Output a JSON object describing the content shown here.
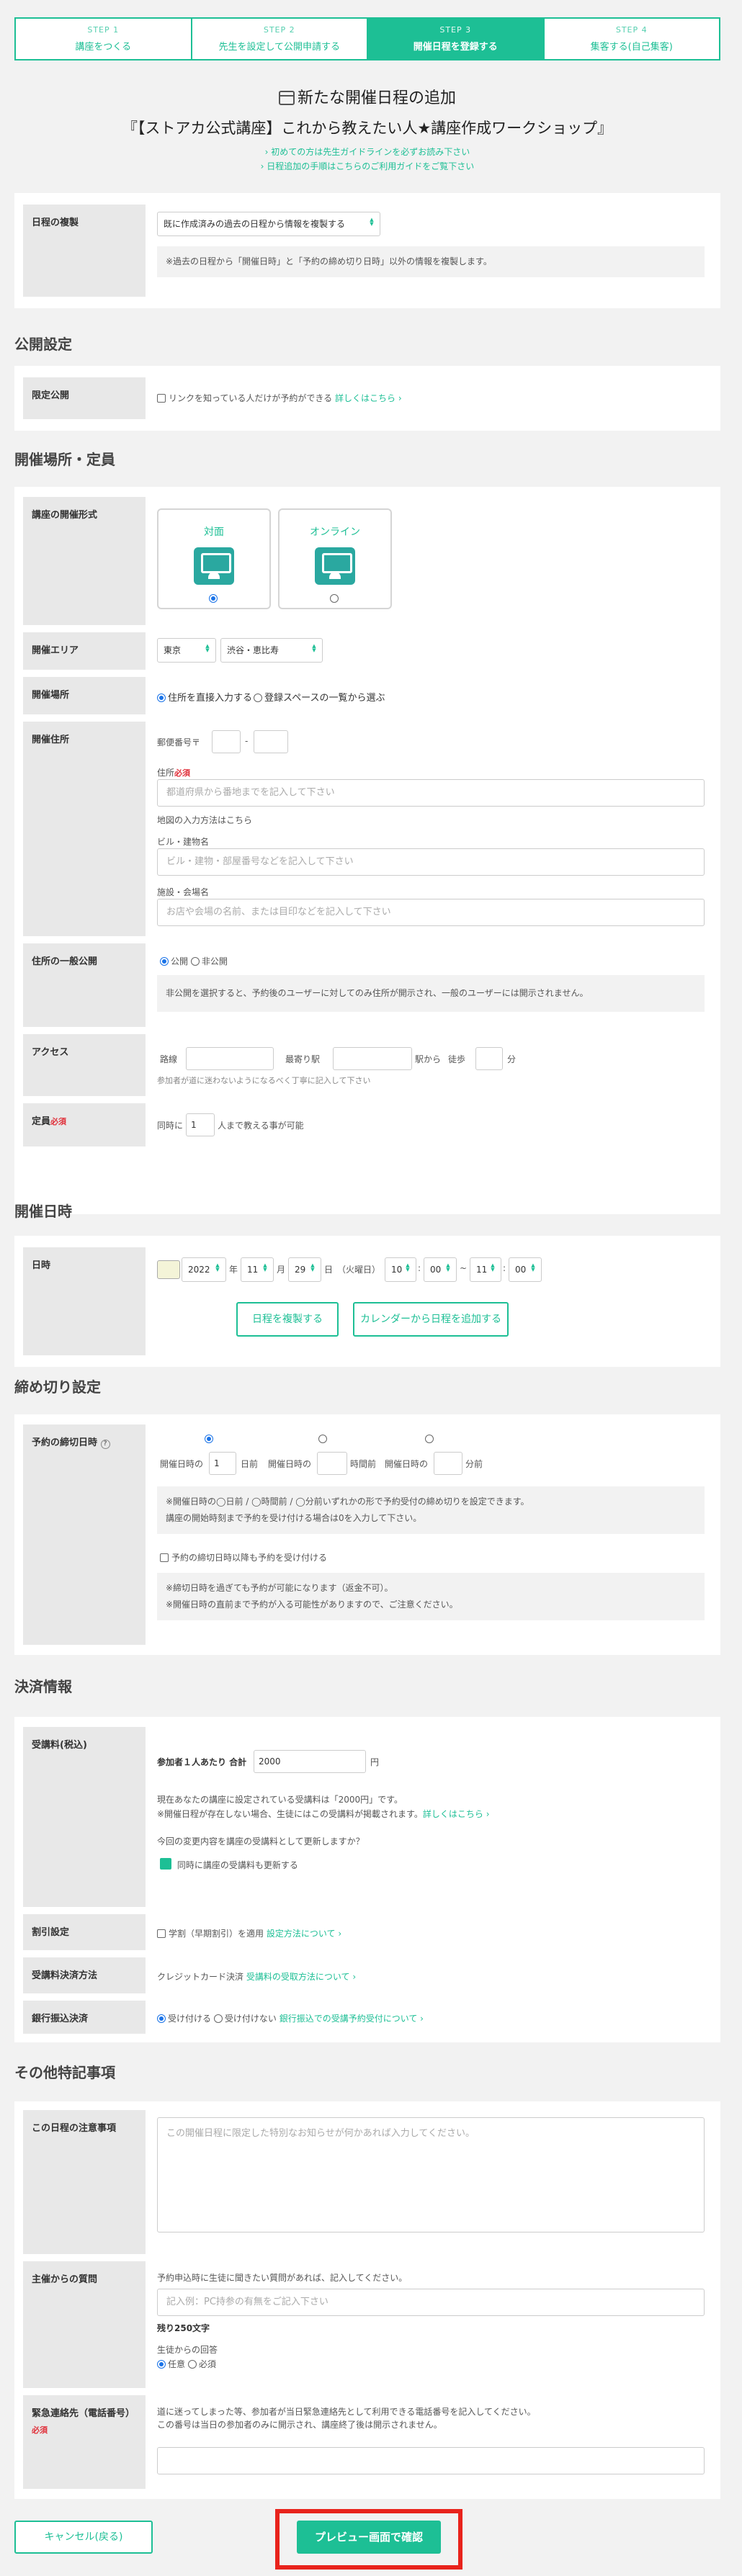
{
  "steps": [
    {
      "num": "STEP 1",
      "label": "講座をつくる"
    },
    {
      "num": "STEP 2",
      "label": "先生を設定して公開申請する"
    },
    {
      "num": "STEP 3",
      "label": "開催日程を登録する"
    },
    {
      "num": "STEP 4",
      "label": "集客する(自己集客)"
    }
  ],
  "page_title": "新たな開催日程の追加",
  "course_title": "『【ストアカ公式講座】これから教えたい人★講座作成ワークショップ』",
  "guides": [
    "初めての方は先生ガイドラインを必ずお読み下さい",
    "日程追加の手順はこちらのご利用ガイドをご覧下さい"
  ],
  "copy_schedule": {
    "label": "日程の複製",
    "select": "既に作成済みの過去の日程から情報を複製する",
    "note": "※過去の日程から「開催日時」と「予約の締め切り日時」以外の情報を複製します。"
  },
  "public_settings": {
    "heading": "公開設定",
    "limited_label": "限定公開",
    "limited_text": "リンクを知っている人だけが予約ができる",
    "limited_link": "詳しくはこちら"
  },
  "venue": {
    "heading": "開催場所・定員",
    "format_label": "講座の開催形式",
    "format_inperson": "対面",
    "format_online": "オンライン",
    "area_label": "開催エリア",
    "area_pref": "東京",
    "area_city": "渋谷・恵比寿",
    "place_label": "開催場所",
    "place_direct": "住所を直接入力する",
    "place_registered": "登録スペースの一覧から選ぶ",
    "address_label": "開催住所",
    "postal_label": "郵便番号〒",
    "postal_sep": "-",
    "address_field_label": "住所",
    "required": "必須",
    "address_placeholder": "都道府県から番地までを記入して下さい",
    "map_link": "地図の入力方法はこちら",
    "building_label": "ビル・建物名",
    "building_placeholder": "ビル・建物・部屋番号などを記入して下さい",
    "facility_label": "施設・会場名",
    "facility_placeholder": "お店や会場の名前、または目印などを記入して下さい",
    "disclosure_label": "住所の一般公開",
    "public": "公開",
    "private": "非公開",
    "disclosure_note": "非公開を選択すると、予約後のユーザーに対してのみ住所が開示され、一般のユーザーには開示されません。",
    "access_label": "アクセス",
    "line_label": "路線",
    "station_label": "最寄り駅",
    "from_station": "駅から",
    "walk": "徒歩",
    "minutes": "分",
    "access_note": "参加者が道に迷わないようになるべく丁寧に記入して下さい",
    "capacity_label": "定員",
    "capacity_prefix": "同時に",
    "capacity_value": "1",
    "capacity_suffix": "人まで教える事が可能"
  },
  "datetime": {
    "heading": "開催日時",
    "label": "日時",
    "year": "2022",
    "year_unit": "年",
    "month": "11",
    "month_unit": "月",
    "day": "29",
    "day_unit": "日",
    "weekday": "（火曜日）",
    "start_hour": "10",
    "start_min": "00",
    "end_hour": "11",
    "end_min": "00",
    "time_sep": ":",
    "range_sep": "~",
    "copy_btn": "日程を複製する",
    "calendar_btn": "カレンダーから日程を追加する"
  },
  "deadline": {
    "heading": "締め切り設定",
    "label": "予約の締切日時",
    "help_icon": "?",
    "prefix": "開催日時の",
    "days_value": "1",
    "days_unit": "日前",
    "hours_unit": "時間前",
    "minutes_unit": "分前",
    "note": "※開催日時の◯日前 / ◯時間前 / ◯分前いずれかの形で予約受付の締め切りを設定できます。\n講座の開始時刻まで予約を受け付ける場合は0を入力して下さい。",
    "after_label": "予約の締切日時以降も予約を受け付ける",
    "after_note": "※締切日時を過ぎても予約が可能になります（返金不可）。\n※開催日時の直前まで予約が入る可能性がありますので、ご注意ください。"
  },
  "payment": {
    "heading": "決済情報",
    "fee_label": "受講料(税込)",
    "per_person": "参加者１人あたり 合計",
    "fee_value": "2000",
    "fee_unit": "円",
    "fee_note1": "現在あなたの講座に設定されている受講料は「2000円」です。",
    "fee_note2": "※開催日程が存在しない場合、生徒にはこの受講料が掲載されます。",
    "fee_link": "詳しくはこちら",
    "update_q": "今回の変更内容を講座の受講料として更新しますか？",
    "update_check": "同時に講座の受講料も更新する",
    "discount_label": "割引設定",
    "discount_text": "学割（早期割引）を適用",
    "discount_link": "設定方法について",
    "method_label": "受講料決済方法",
    "method_text": "クレジットカード決済",
    "method_link": "受講料の受取方法について",
    "bank_label": "銀行振込決済",
    "bank_accept": "受け付ける",
    "bank_reject": "受け付けない",
    "bank_link": "銀行振込での受講予約受付について"
  },
  "other": {
    "heading": "その他特記事項",
    "notes_label": "この日程の注意事項",
    "notes_placeholder": "この開催日程に限定した特別なお知らせが何かあれば入力してください。",
    "question_label": "主催からの質問",
    "question_desc": "予約申込時に生徒に聞きたい質問があれば、記入してください。",
    "question_placeholder": "記入例：PC持参の有無をご記入下さい",
    "remaining": "残り250文字",
    "answer_label": "生徒からの回答",
    "optional": "任意",
    "required": "必須",
    "emergency_label": "緊急連絡先（電話番号）",
    "emergency_required": "必須",
    "emergency_note1": "道に迷ってしまった等、参加者が当日緊急連絡先として利用できる電話番号を記入してください。",
    "emergency_note2": "この番号は当日の参加者のみに開示され、講座終了後は開示されません。"
  },
  "footer": {
    "cancel": "キャンセル(戻る)",
    "preview": "プレビュー画面で確認"
  },
  "colors": {
    "accent": "#1dbf95",
    "required": "#e0303a",
    "highlight": "#e8231c"
  }
}
